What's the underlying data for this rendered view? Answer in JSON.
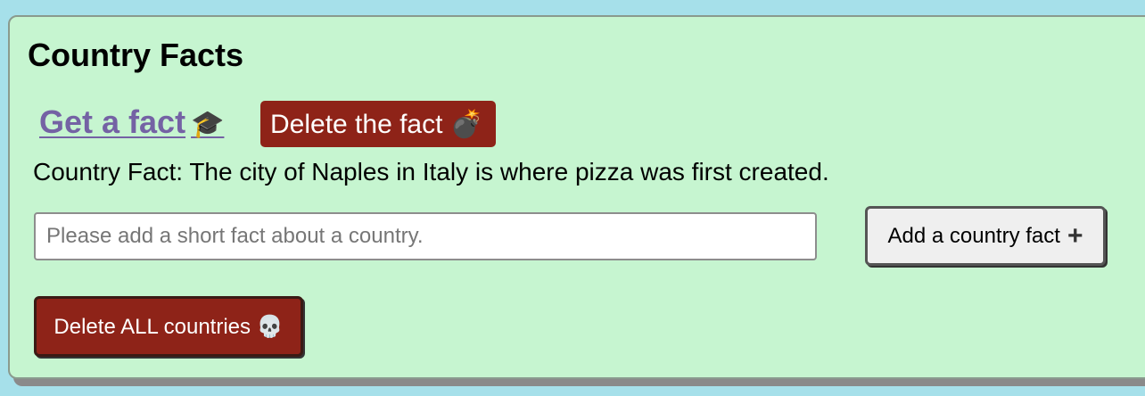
{
  "app": {
    "title": "Country Facts"
  },
  "actions": {
    "get_fact_label": "Get a fact",
    "get_fact_emoji": "🎓",
    "delete_fact_label": "Delete the fact",
    "delete_fact_emoji": "💣",
    "add_fact_label": "Add a country fact",
    "add_fact_icon": "+",
    "delete_all_label": "Delete ALL countries",
    "delete_all_emoji": "💀"
  },
  "fact": {
    "text": "Country Fact: The city of Naples in Italy is where pizza was first created."
  },
  "input": {
    "value": "",
    "placeholder": "Please add a short fact about a country."
  },
  "colors": {
    "background": "#a6e0ea",
    "panel": "#c6f5d0",
    "danger": "#8e2318",
    "link": "#7462a4"
  }
}
